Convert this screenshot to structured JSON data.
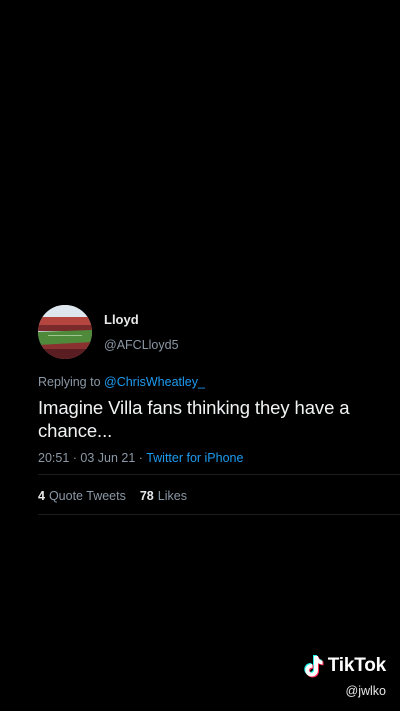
{
  "tweet": {
    "display_name": "Lloyd",
    "handle": "@AFCLloyd5",
    "replying_prefix": "Replying to ",
    "replying_to": "@ChrisWheatley_",
    "text": "Imagine Villa fans thinking they have a chance...",
    "timestamp": "20:51 · 03 Jun 21 · ",
    "source": "Twitter for iPhone"
  },
  "stats": {
    "quote_count": "4",
    "quote_label": "Quote Tweets",
    "like_count": "78",
    "like_label": "Likes"
  },
  "watermark": {
    "brand": "TikTok",
    "user": "@jwlko"
  },
  "colors": {
    "background": "#000000",
    "link": "#1d9bf0",
    "secondary_text": "#8b98a5",
    "primary_text": "#e7e9ea"
  },
  "icons": {
    "avatar": "stadium-photo-avatar",
    "brand_logo": "tiktok-note-icon"
  }
}
